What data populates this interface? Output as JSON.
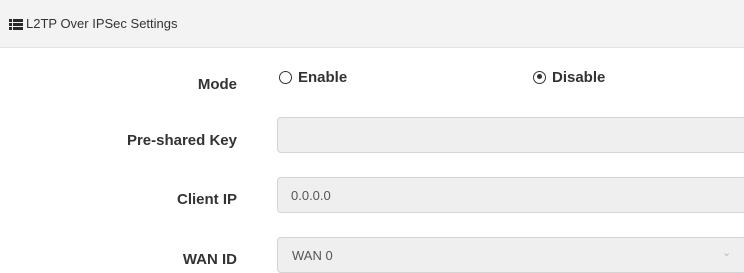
{
  "header": {
    "title": "L2TP Over IPSec Settings",
    "icon": "list-icon"
  },
  "mode": {
    "label": "Mode",
    "options": [
      {
        "label": "Enable",
        "checked": false
      },
      {
        "label": "Disable",
        "checked": true
      }
    ]
  },
  "preshared_key": {
    "label": "Pre-shared Key",
    "value": ""
  },
  "client_ip": {
    "label": "Client IP",
    "value": "0.0.0.0"
  },
  "wan_id": {
    "label": "WAN ID",
    "selected": "WAN 0"
  }
}
